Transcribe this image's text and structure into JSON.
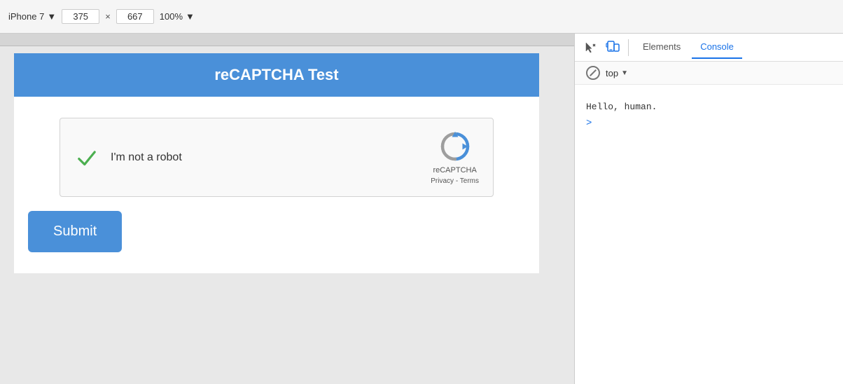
{
  "toolbar": {
    "device_name": "iPhone 7",
    "chevron": "▼",
    "width_value": "375",
    "height_value": "667",
    "separator": "×",
    "zoom_value": "100%",
    "zoom_chevron": "▼"
  },
  "page": {
    "header_title": "reCAPTCHA Test",
    "header_bg": "#4a90d9"
  },
  "recaptcha": {
    "label": "I'm not a robot",
    "brand": "reCAPTCHA",
    "privacy": "Privacy",
    "dash": " - ",
    "terms": "Terms"
  },
  "submit_button": "Submit",
  "devtools": {
    "tab_elements": "Elements",
    "tab_console": "Console",
    "context_label": "top",
    "console_output": "Hello, human.",
    "prompt_symbol": ">"
  }
}
